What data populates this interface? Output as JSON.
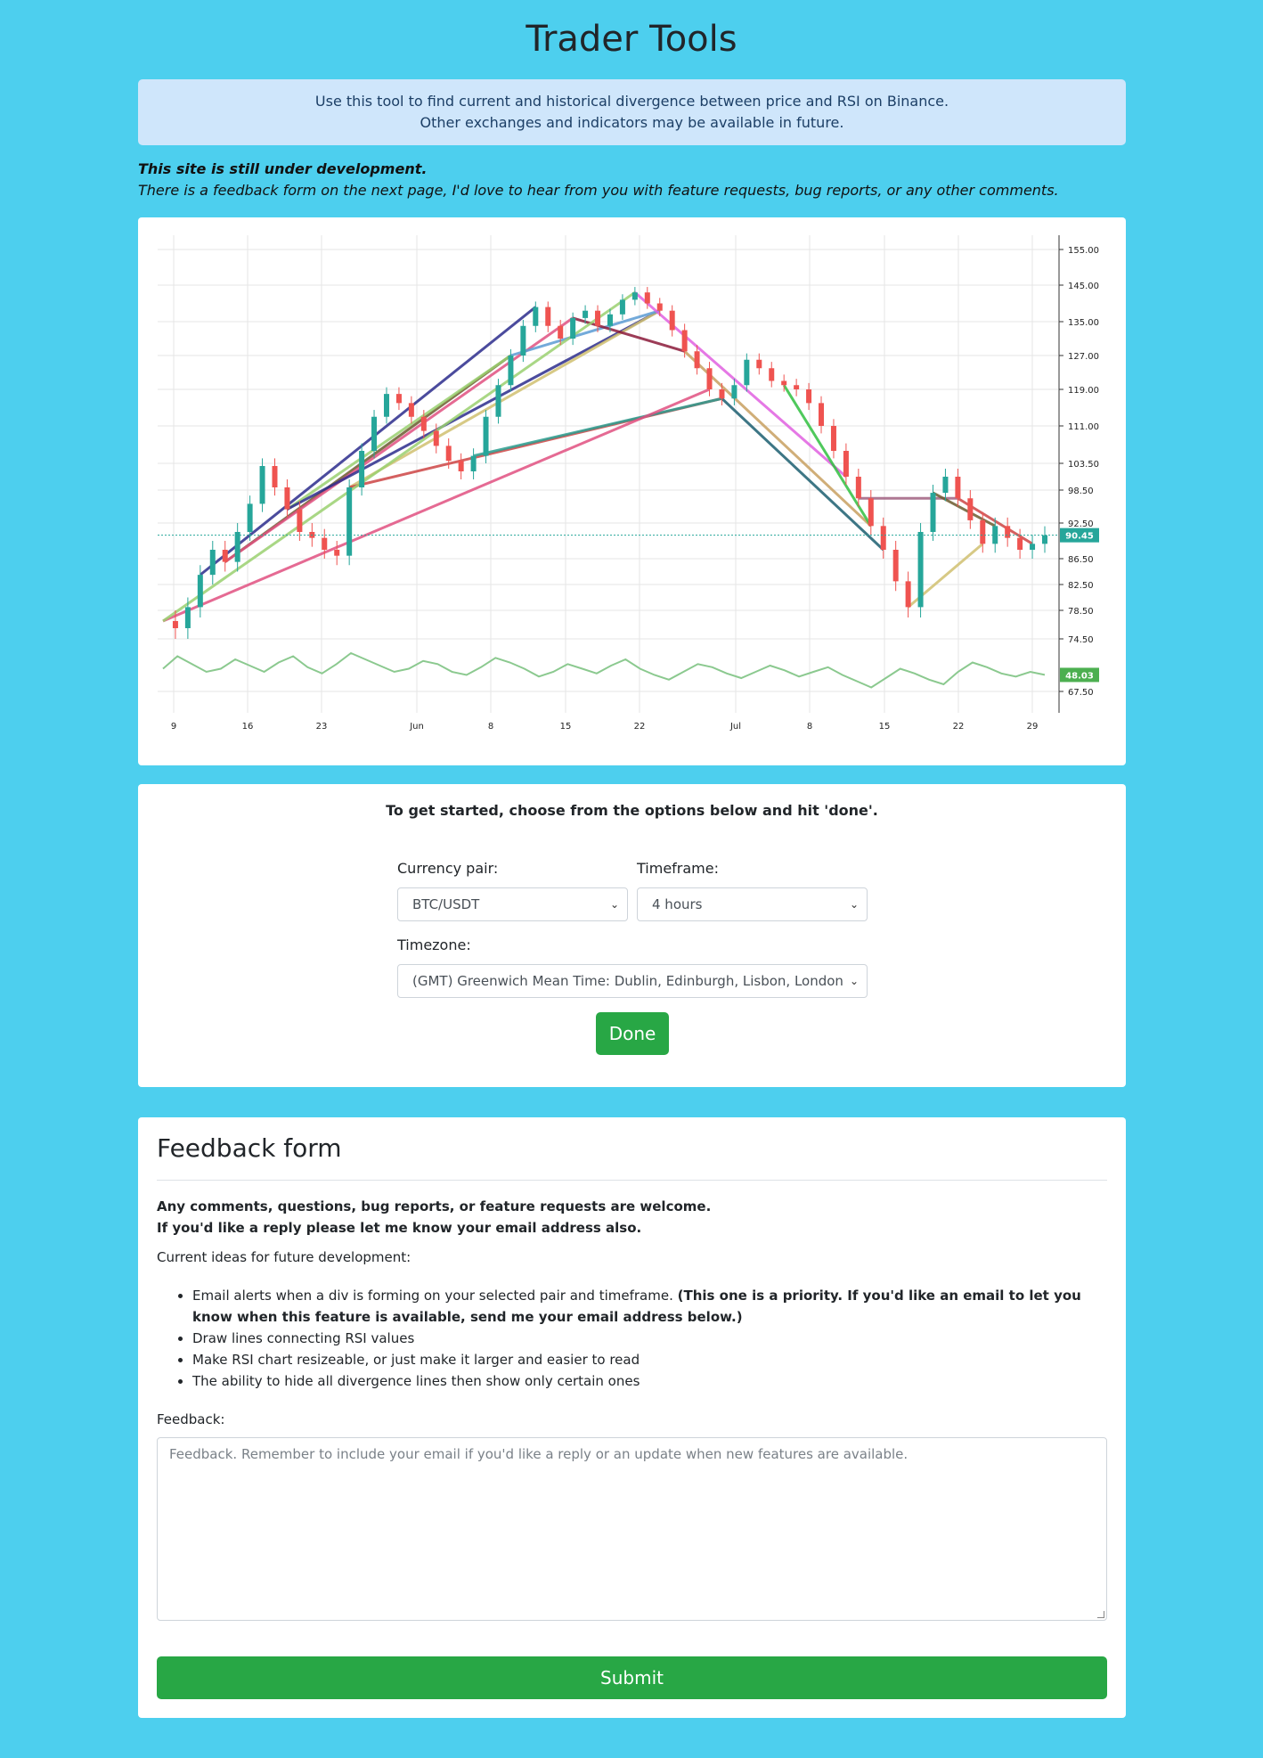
{
  "header": {
    "title": "Trader Tools"
  },
  "alert": {
    "line1": "Use this tool to find current and historical divergence between price and RSI on Binance.",
    "line2": "Other exchanges and indicators may be available in future."
  },
  "dev_note": {
    "line1": "This site is still under development.",
    "line2": "There is a feedback form on the next page, I'd love to hear from you with feature requests, bug reports, or any other comments."
  },
  "chart_data": {
    "type": "candlestick",
    "x_tick_labels": [
      "9",
      "16",
      "23",
      "Jun",
      "8",
      "15",
      "22",
      "Jul",
      "8",
      "15",
      "22",
      "29"
    ],
    "y_tick_labels": [
      "155.00",
      "145.00",
      "135.00",
      "127.00",
      "119.00",
      "111.00",
      "103.50",
      "98.50",
      "92.50",
      "86.50",
      "82.50",
      "78.50",
      "74.50",
      "67.50"
    ],
    "y_ticks": [
      155,
      145,
      135,
      127,
      119,
      111,
      103.5,
      98.5,
      92.5,
      86.5,
      82.5,
      78.5,
      74.5,
      67.5
    ],
    "price_last": 90.45,
    "price_last_label": "90.45",
    "rsi_last": 48.03,
    "rsi_last_label": "48.03",
    "price_series_approx": [
      77,
      76,
      79,
      84,
      88,
      86,
      91,
      96,
      103,
      99,
      95,
      91,
      90,
      88,
      87,
      99,
      106,
      113,
      118,
      116,
      113,
      110,
      107,
      104,
      102,
      105,
      113,
      120,
      127,
      134,
      139,
      134,
      131,
      136,
      138,
      134,
      137,
      141,
      143,
      140,
      138,
      133,
      128,
      124,
      119,
      117,
      120,
      126,
      124,
      121,
      120,
      119,
      116,
      111,
      106,
      101,
      97,
      92,
      88,
      83,
      79,
      91,
      98,
      101,
      97,
      93,
      89,
      92,
      90,
      88,
      89,
      90.45
    ],
    "rsi_series_approx": [
      52,
      60,
      55,
      50,
      52,
      58,
      54,
      50,
      56,
      60,
      53,
      49,
      55,
      62,
      58,
      54,
      50,
      52,
      57,
      55,
      50,
      48,
      53,
      59,
      56,
      52,
      47,
      50,
      55,
      52,
      49,
      54,
      58,
      52,
      48,
      45,
      50,
      55,
      53,
      49,
      46,
      50,
      54,
      51,
      47,
      50,
      53,
      48,
      44,
      40,
      46,
      52,
      49,
      45,
      42,
      50,
      56,
      53,
      49,
      47,
      50,
      48.03
    ],
    "grid": true,
    "legend": "none"
  },
  "options": {
    "title": "To get started, choose from the options below and hit 'done'.",
    "currency_label": "Currency pair:",
    "currency_value": "BTC/USDT",
    "timeframe_label": "Timeframe:",
    "timeframe_value": "4 hours",
    "timezone_label": "Timezone:",
    "timezone_value": "(GMT) Greenwich Mean Time: Dublin, Edinburgh, Lisbon, London",
    "done_label": "Done"
  },
  "feedback": {
    "title": "Feedback form",
    "intro1": "Any comments, questions, bug reports, or feature requests are welcome.",
    "intro2": "If you'd like a reply please let me know your email address also.",
    "ideas_heading": "Current ideas for future development:",
    "idea1_text": "Email alerts when a div is forming on your selected pair and timeframe.",
    "idea1_bold": "(This one is a priority. If you'd like an email to let you know when this feature is available, send me your email address below.)",
    "idea2": "Draw lines connecting RSI values",
    "idea3": "Make RSI chart resizeable, or just make it larger and easier to read",
    "idea4": "The ability to hide all divergence lines then show only certain ones",
    "label": "Feedback:",
    "placeholder": "Feedback. Remember to include your email if you'd like a reply or an update when new features are available.",
    "submit_label": "Submit"
  },
  "colors": {
    "background": "#4dcfee",
    "success": "#28a745",
    "candle_up": "#26a69a",
    "candle_down": "#ef5350",
    "rsi_line": "#8bc98f",
    "last_price_badge": "#26a69a",
    "last_rsi_badge": "#4caf50"
  }
}
